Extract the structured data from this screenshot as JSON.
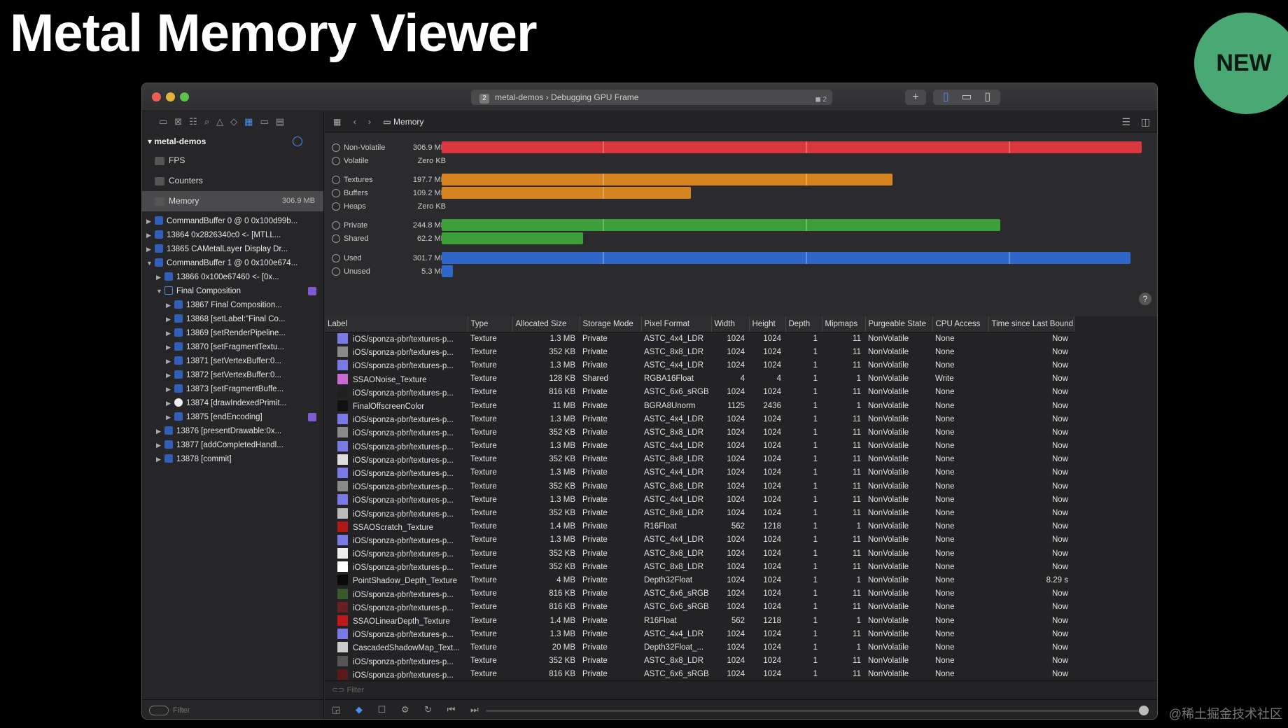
{
  "slide": {
    "title": "Metal Memory Viewer",
    "badge": "NEW",
    "watermark": "@稀土掘金技术社区"
  },
  "window": {
    "scheme_title": "metal-demos › Debugging GPU Frame",
    "scheme_badge": "2",
    "issue_count": "2"
  },
  "navigator": {
    "project": "metal-demos",
    "items": [
      {
        "label": "FPS"
      },
      {
        "label": "Counters"
      },
      {
        "label": "Memory",
        "size": "306.9 MB"
      }
    ],
    "tree": [
      {
        "label": "CommandBuffer 0 @ 0 0x100d99b...",
        "indent": 1,
        "arrow": "▶",
        "icon": "cb"
      },
      {
        "label": "13864 0x2826340c0 <- [MTLL...",
        "indent": 1,
        "arrow": "▶",
        "icon": "call"
      },
      {
        "label": "13865 CAMetalLayer Display Dr...",
        "indent": 1,
        "arrow": "▶",
        "icon": "call"
      },
      {
        "label": "CommandBuffer 1 @ 0 0x100e674...",
        "indent": 1,
        "arrow": "▼",
        "icon": "cb"
      },
      {
        "label": "13866 0x100e67460 <- [0x...",
        "indent": 2,
        "arrow": "▶",
        "icon": "call"
      },
      {
        "label": "Final Composition",
        "indent": 2,
        "arrow": "▼",
        "icon": "enc",
        "flag": true
      },
      {
        "label": "13867 Final Composition...",
        "indent": 3,
        "arrow": "▶",
        "icon": "call"
      },
      {
        "label": "13868 [setLabel:\"Final Co...",
        "indent": 3,
        "arrow": "▶",
        "icon": "call"
      },
      {
        "label": "13869 [setRenderPipeline...",
        "indent": 3,
        "arrow": "▶",
        "icon": "call"
      },
      {
        "label": "13870 [setFragmentTextu...",
        "indent": 3,
        "arrow": "▶",
        "icon": "call"
      },
      {
        "label": "13871 [setVertexBuffer:0...",
        "indent": 3,
        "arrow": "▶",
        "icon": "call"
      },
      {
        "label": "13872 [setVertexBuffer:0...",
        "indent": 3,
        "arrow": "▶",
        "icon": "call"
      },
      {
        "label": "13873 [setFragmentBuffe...",
        "indent": 3,
        "arrow": "▶",
        "icon": "call"
      },
      {
        "label": "13874 [drawIndexedPrimit...",
        "indent": 3,
        "arrow": "▶",
        "icon": "draw"
      },
      {
        "label": "13875 [endEncoding]",
        "indent": 3,
        "arrow": "▶",
        "icon": "call",
        "flag": true
      },
      {
        "label": "13876 [presentDrawable:0x...",
        "indent": 2,
        "arrow": "▶",
        "icon": "call"
      },
      {
        "label": "13877 [addCompletedHandl...",
        "indent": 2,
        "arrow": "▶",
        "icon": "call"
      },
      {
        "label": "13878 [commit]",
        "indent": 2,
        "arrow": "▶",
        "icon": "call"
      }
    ],
    "filter_placeholder": "Filter"
  },
  "jumpbar": {
    "crumb": "Memory"
  },
  "chart_data": {
    "type": "bar",
    "categories": [
      "Non-Volatile",
      "Volatile",
      "Textures",
      "Buffers",
      "Heaps",
      "Private",
      "Shared",
      "Used",
      "Unused"
    ],
    "values_mb": [
      306.9,
      0,
      197.7,
      109.2,
      0,
      244.8,
      62.2,
      301.7,
      5.3
    ],
    "value_labels": [
      "306.9 MB",
      "Zero KB",
      "197.7 MB",
      "109.2 MB",
      "Zero KB",
      "244.8 MB",
      "62.2 MB",
      "301.7 MB",
      "5.3 MB"
    ],
    "bar_colors": [
      "#d9363e",
      "#d9363e",
      "#d6841f",
      "#d6841f",
      "#d6841f",
      "#3c9f3a",
      "#3c9f3a",
      "#2e66c9",
      "#2e66c9"
    ],
    "xlim": [
      0,
      306.9
    ]
  },
  "table": {
    "headers": [
      "Label",
      "Type",
      "Allocated Size",
      "Storage Mode",
      "Pixel Format",
      "Width",
      "Height",
      "Depth",
      "Mipmaps",
      "Purgeable State",
      "CPU Access",
      "Time since Last Bound"
    ],
    "rows": [
      [
        "iOS/sponza-pbr/textures-p...",
        "Texture",
        "1.3 MB",
        "Private",
        "ASTC_4x4_LDR",
        "1024",
        "1024",
        "1",
        "11",
        "NonVolatile",
        "None",
        "Now",
        "#7a7ae6"
      ],
      [
        "iOS/sponza-pbr/textures-p...",
        "Texture",
        "352 KB",
        "Private",
        "ASTC_8x8_LDR",
        "1024",
        "1024",
        "1",
        "11",
        "NonVolatile",
        "None",
        "Now",
        "#8a8a8a"
      ],
      [
        "iOS/sponza-pbr/textures-p...",
        "Texture",
        "1.3 MB",
        "Private",
        "ASTC_4x4_LDR",
        "1024",
        "1024",
        "1",
        "11",
        "NonVolatile",
        "None",
        "Now",
        "#7a7ae6"
      ],
      [
        "SSAONoise_Texture",
        "Texture",
        "128 KB",
        "Shared",
        "RGBA16Float",
        "4",
        "4",
        "1",
        "1",
        "NonVolatile",
        "Write",
        "Now",
        "#c86ad0"
      ],
      [
        "iOS/sponza-pbr/textures-p...",
        "Texture",
        "816 KB",
        "Private",
        "ASTC_6x6_sRGB",
        "1024",
        "1024",
        "1",
        "11",
        "NonVolatile",
        "None",
        "Now",
        "#202020"
      ],
      [
        "FinalOffscreenColor",
        "Texture",
        "11 MB",
        "Private",
        "BGRA8Unorm",
        "1125",
        "2436",
        "1",
        "1",
        "NonVolatile",
        "None",
        "Now",
        "#111111"
      ],
      [
        "iOS/sponza-pbr/textures-p...",
        "Texture",
        "1.3 MB",
        "Private",
        "ASTC_4x4_LDR",
        "1024",
        "1024",
        "1",
        "11",
        "NonVolatile",
        "None",
        "Now",
        "#7a7ae6"
      ],
      [
        "iOS/sponza-pbr/textures-p...",
        "Texture",
        "352 KB",
        "Private",
        "ASTC_8x8_LDR",
        "1024",
        "1024",
        "1",
        "11",
        "NonVolatile",
        "None",
        "Now",
        "#8a8a8a"
      ],
      [
        "iOS/sponza-pbr/textures-p...",
        "Texture",
        "1.3 MB",
        "Private",
        "ASTC_4x4_LDR",
        "1024",
        "1024",
        "1",
        "11",
        "NonVolatile",
        "None",
        "Now",
        "#7a7ae6"
      ],
      [
        "iOS/sponza-pbr/textures-p...",
        "Texture",
        "352 KB",
        "Private",
        "ASTC_8x8_LDR",
        "1024",
        "1024",
        "1",
        "11",
        "NonVolatile",
        "None",
        "Now",
        "#dddddd"
      ],
      [
        "iOS/sponza-pbr/textures-p...",
        "Texture",
        "1.3 MB",
        "Private",
        "ASTC_4x4_LDR",
        "1024",
        "1024",
        "1",
        "11",
        "NonVolatile",
        "None",
        "Now",
        "#7a7ae6"
      ],
      [
        "iOS/sponza-pbr/textures-p...",
        "Texture",
        "352 KB",
        "Private",
        "ASTC_8x8_LDR",
        "1024",
        "1024",
        "1",
        "11",
        "NonVolatile",
        "None",
        "Now",
        "#8a8a8a"
      ],
      [
        "iOS/sponza-pbr/textures-p...",
        "Texture",
        "1.3 MB",
        "Private",
        "ASTC_4x4_LDR",
        "1024",
        "1024",
        "1",
        "11",
        "NonVolatile",
        "None",
        "Now",
        "#7a7ae6"
      ],
      [
        "iOS/sponza-pbr/textures-p...",
        "Texture",
        "352 KB",
        "Private",
        "ASTC_8x8_LDR",
        "1024",
        "1024",
        "1",
        "11",
        "NonVolatile",
        "None",
        "Now",
        "#bbbbbb"
      ],
      [
        "SSAOScratch_Texture",
        "Texture",
        "1.4 MB",
        "Private",
        "R16Float",
        "562",
        "1218",
        "1",
        "1",
        "NonVolatile",
        "None",
        "Now",
        "#b01818"
      ],
      [
        "iOS/sponza-pbr/textures-p...",
        "Texture",
        "1.3 MB",
        "Private",
        "ASTC_4x4_LDR",
        "1024",
        "1024",
        "1",
        "11",
        "NonVolatile",
        "None",
        "Now",
        "#7a7ae6"
      ],
      [
        "iOS/sponza-pbr/textures-p...",
        "Texture",
        "352 KB",
        "Private",
        "ASTC_8x8_LDR",
        "1024",
        "1024",
        "1",
        "11",
        "NonVolatile",
        "None",
        "Now",
        "#eeeeee"
      ],
      [
        "iOS/sponza-pbr/textures-p...",
        "Texture",
        "352 KB",
        "Private",
        "ASTC_8x8_LDR",
        "1024",
        "1024",
        "1",
        "11",
        "NonVolatile",
        "None",
        "Now",
        "#ffffff"
      ],
      [
        "PointShadow_Depth_Texture",
        "Texture",
        "4 MB",
        "Private",
        "Depth32Float",
        "1024",
        "1024",
        "1",
        "1",
        "NonVolatile",
        "None",
        "8.29 s",
        "#0a0a0a"
      ],
      [
        "iOS/sponza-pbr/textures-p...",
        "Texture",
        "816 KB",
        "Private",
        "ASTC_6x6_sRGB",
        "1024",
        "1024",
        "1",
        "11",
        "NonVolatile",
        "None",
        "Now",
        "#3a5a2a"
      ],
      [
        "iOS/sponza-pbr/textures-p...",
        "Texture",
        "816 KB",
        "Private",
        "ASTC_6x6_sRGB",
        "1024",
        "1024",
        "1",
        "11",
        "NonVolatile",
        "None",
        "Now",
        "#6a2020"
      ],
      [
        "SSAOLinearDepth_Texture",
        "Texture",
        "1.4 MB",
        "Private",
        "R16Float",
        "562",
        "1218",
        "1",
        "1",
        "NonVolatile",
        "None",
        "Now",
        "#c01818"
      ],
      [
        "iOS/sponza-pbr/textures-p...",
        "Texture",
        "1.3 MB",
        "Private",
        "ASTC_4x4_LDR",
        "1024",
        "1024",
        "1",
        "11",
        "NonVolatile",
        "None",
        "Now",
        "#7a7ae6"
      ],
      [
        "CascadedShadowMap_Text...",
        "Texture",
        "20 MB",
        "Private",
        "Depth32Float_...",
        "1024",
        "1024",
        "1",
        "1",
        "NonVolatile",
        "None",
        "Now",
        "#cccccc"
      ],
      [
        "iOS/sponza-pbr/textures-p...",
        "Texture",
        "352 KB",
        "Private",
        "ASTC_8x8_LDR",
        "1024",
        "1024",
        "1",
        "11",
        "NonVolatile",
        "None",
        "Now",
        "#555555"
      ],
      [
        "iOS/sponza-pbr/textures-p...",
        "Texture",
        "816 KB",
        "Private",
        "ASTC_6x6_sRGB",
        "1024",
        "1024",
        "1",
        "11",
        "NonVolatile",
        "None",
        "Now",
        "#5a1a1a"
      ]
    ],
    "filter_placeholder": "Filter"
  }
}
